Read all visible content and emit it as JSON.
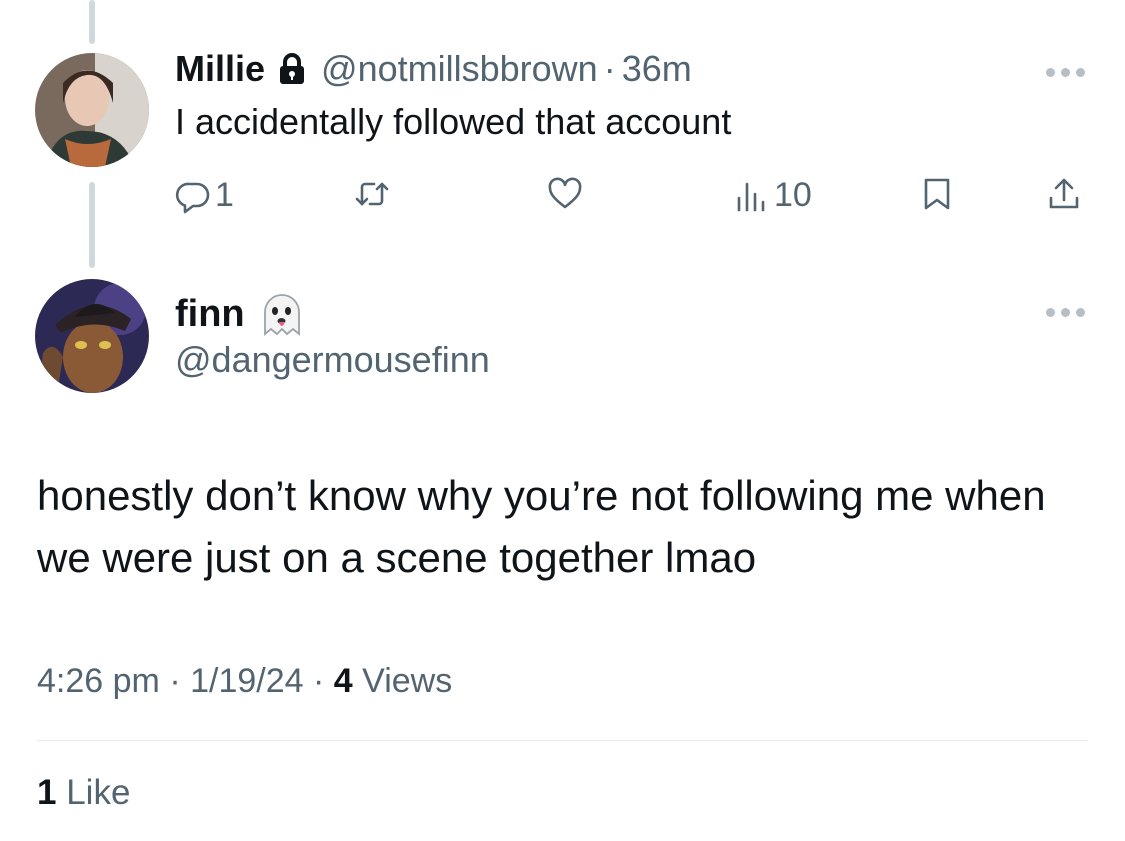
{
  "reply_tweet": {
    "display_name": "Millie",
    "handle": "@notmillsbbrown",
    "separator": "·",
    "time": "36m",
    "text": "I accidentally followed that account",
    "actions": {
      "reply_count": "1",
      "retweet_count": "",
      "like_count": "",
      "views_count": "10"
    }
  },
  "main_tweet": {
    "display_name": "finn",
    "handle": "@dangermousefinn",
    "text": "honestly don’t know why you’re not following me when we were just on a scene together lmao",
    "time": "4:26 pm",
    "separator": "·",
    "date": "1/19/24",
    "views_count": "4",
    "views_label": "Views",
    "likes_count": "1",
    "likes_label": "Like"
  },
  "icons": {
    "lock": "lock-icon",
    "ghost": "ghost-emoji-icon",
    "more": "more-horizontal-icon",
    "reply": "reply-icon",
    "retweet": "retweet-icon",
    "like": "heart-icon",
    "views": "views-chart-icon",
    "bookmark": "bookmark-icon",
    "share": "share-icon"
  },
  "colors": {
    "text": "#0f1419",
    "secondary": "#536471",
    "thread_line": "#cfd9de",
    "divider": "#e6ebee"
  }
}
